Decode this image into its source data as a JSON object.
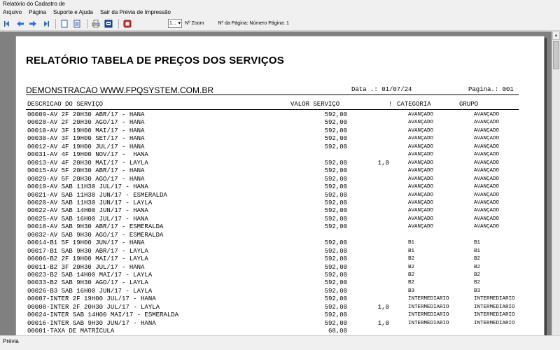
{
  "window": {
    "title": "Relatório do Cadastro de"
  },
  "menu": [
    "Arquivo",
    "Página",
    "Suporte e Ajuda",
    "Sair da Prévia de Impressão"
  ],
  "toolbar": {
    "zoom_value": "1...",
    "zoom_label": "Nº Zoom",
    "page_label": "Nº da Página: Número Página: 1"
  },
  "report": {
    "title": "RELATÓRIO TABELA DE PREÇOS DOS SERVIÇOS",
    "company": "DEMONSTRACAO WWW.FPQSYSTEM.COM.BR",
    "date": "Data .: 01/07/24",
    "page": "Pagina.: 001",
    "headers": {
      "description": "DESCRICAO DO SERVIÇO",
      "value": "VALOR SERVIÇO",
      "extra": "!",
      "category": "CATEGORIA",
      "group": "GRUPO"
    },
    "rows": [
      {
        "desc": "00009-AV 2F 20H30 ABR/17 - HANA",
        "value": "592,00",
        "extra": "",
        "category": "AVANÇADO",
        "group": "AVANÇADO"
      },
      {
        "desc": "00028-AV 2F 20H30 AGO/17 - HANA",
        "value": "592,00",
        "extra": "",
        "category": "AVANÇADO",
        "group": "AVANÇADO"
      },
      {
        "desc": "00010-AV 3F 19H00 MAI/17 - HANA",
        "value": "592,00",
        "extra": "",
        "category": "AVANÇADO",
        "group": "AVANÇADO"
      },
      {
        "desc": "00030-AV 3F 19H00 SET/17 - HANA",
        "value": "592,00",
        "extra": "",
        "category": "AVANÇADO",
        "group": "AVANÇADO"
      },
      {
        "desc": "00012-AV 4F 19H00 JUL/17 - HANA",
        "value": "592,00",
        "extra": "",
        "category": "AVANÇADO",
        "group": "AVANÇADO"
      },
      {
        "desc": "00031-AV 4F 19H00 NOV/17 -  HANA",
        "value": "",
        "extra": "",
        "category": "AVANÇADO",
        "group": "AVANÇADO"
      },
      {
        "desc": "00013-AV 4F 20H30 MAI/17 - LAYLA",
        "value": "592,00",
        "extra": "1,0",
        "category": "AVANÇADO",
        "group": "AVANÇADO"
      },
      {
        "desc": "00015-AV 5F 20H30 ABR/17 - HANA",
        "value": "592,00",
        "extra": "",
        "category": "AVANÇADO",
        "group": "AVANÇADO"
      },
      {
        "desc": "00029-AV 5F 20H30 AGO/17 - HANA",
        "value": "592,00",
        "extra": "",
        "category": "AVANÇADO",
        "group": "AVANÇADO"
      },
      {
        "desc": "00019-AV SAB 11H30 JUL/17 - HANA",
        "value": "592,00",
        "extra": "",
        "category": "AVANÇADO",
        "group": "AVANÇADO"
      },
      {
        "desc": "00021-AV SAB 11H30 JUN/17 - ESMERALDA",
        "value": "592,00",
        "extra": "",
        "category": "AVANÇADO",
        "group": "AVANÇADO"
      },
      {
        "desc": "00020-AV SAB 11H30 JUN/17 - LAYLA",
        "value": "592,00",
        "extra": "",
        "category": "AVANÇADO",
        "group": "AVANÇADO"
      },
      {
        "desc": "00022-AV SAB 14H00 JUN/17 - HANA",
        "value": "592,00",
        "extra": "",
        "category": "AVANÇADO",
        "group": "AVANÇADO"
      },
      {
        "desc": "00025-AV SAB 16H00 JUL/17 - HANA",
        "value": "592,00",
        "extra": "",
        "category": "AVANÇADO",
        "group": "AVANÇADO"
      },
      {
        "desc": "00018-AV SAB 9H30 ABR/17 - ESMERALDA",
        "value": "592,00",
        "extra": "",
        "category": "AVANÇADO",
        "group": "AVANÇADO"
      },
      {
        "desc": "00032-AV SAB 9H30 AGO/17 - ESMERALDA",
        "value": "",
        "extra": "",
        "category": "",
        "group": ""
      },
      {
        "desc": "00014-B1 5F 19H00 JUN/17 - HANA",
        "value": "592,00",
        "extra": "",
        "category": "B1",
        "group": "B1"
      },
      {
        "desc": "00017-B1 SAB 9H30 ABR/17 - LAYLA",
        "value": "592,00",
        "extra": "",
        "category": "B1",
        "group": "B1"
      },
      {
        "desc": "00006-B2 2F 19H00 MAI/17 - LAYLA",
        "value": "592,00",
        "extra": "",
        "category": "B2",
        "group": "B2"
      },
      {
        "desc": "00011-B2 3F 20H30 JUL/17 - HANA",
        "value": "592,00",
        "extra": "",
        "category": "B2",
        "group": "B2"
      },
      {
        "desc": "00023-B2 SAB 14H00 MAI/17 - LAYLA",
        "value": "592,00",
        "extra": "",
        "category": "B2",
        "group": "B2"
      },
      {
        "desc": "00033-B2 SAB 9H30 AGO/17 - LAYLA",
        "value": "592,00",
        "extra": "",
        "category": "B2",
        "group": "B2"
      },
      {
        "desc": "00026-B3 SAB 16H00 JUN/17 - LAYLA",
        "value": "592,00",
        "extra": "",
        "category": "B3",
        "group": "B3"
      },
      {
        "desc": "00007-INTER 2F 19H00 JUL/17 - HANA",
        "value": "592,00",
        "extra": "",
        "category": "INTERMEDIARIO",
        "group": "INTERMEDIARIO"
      },
      {
        "desc": "00008-INTER 2F 20H30 JUL/17 - LAYLA",
        "value": "592,00",
        "extra": "1,0",
        "category": "INTERMEDIARIO",
        "group": "INTERMEDIARIO"
      },
      {
        "desc": "00024-INTER SAB 14H00 MAI/17 - ESMERALDA",
        "value": "592,00",
        "extra": "",
        "category": "INTERMEDIARIO",
        "group": "INTERMEDIARIO"
      },
      {
        "desc": "00016-INTER SAB 9H30 JUN/17 - HANA",
        "value": "592,00",
        "extra": "1,0",
        "category": "INTERMEDIARIO",
        "group": "INTERMEDIARIO"
      },
      {
        "desc": "00001-TAXA DE MATRÍCULA",
        "value": "68,00",
        "extra": "",
        "category": "",
        "group": ""
      }
    ]
  },
  "status": {
    "text": "Prévia"
  }
}
